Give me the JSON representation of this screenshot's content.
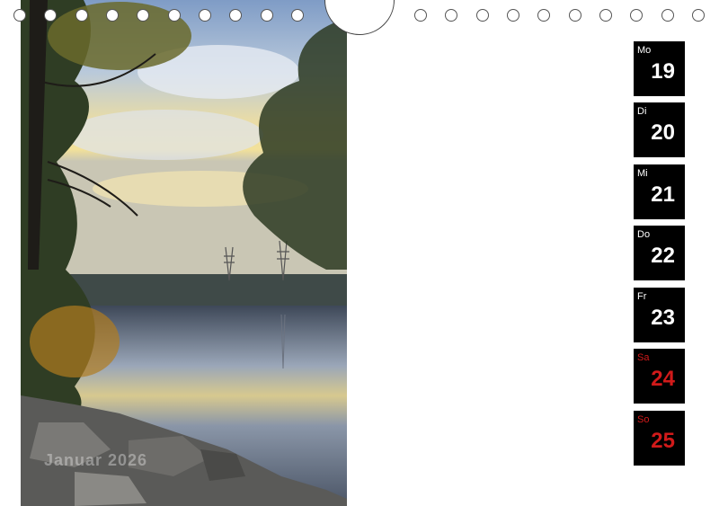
{
  "photo": {
    "caption": "Januar 2026",
    "description_icon": "lake-sunrise-photo"
  },
  "binding": {
    "hole_count_left": 10,
    "hole_count_right": 10
  },
  "days": [
    {
      "weekday": "Mo",
      "day": "19",
      "weekend": false
    },
    {
      "weekday": "Di",
      "day": "20",
      "weekend": false
    },
    {
      "weekday": "Mi",
      "day": "21",
      "weekend": false
    },
    {
      "weekday": "Do",
      "day": "22",
      "weekend": false
    },
    {
      "weekday": "Fr",
      "day": "23",
      "weekend": false
    },
    {
      "weekday": "Sa",
      "day": "24",
      "weekend": true
    },
    {
      "weekday": "So",
      "day": "25",
      "weekend": true
    }
  ],
  "colors": {
    "weekend": "#d11a1a",
    "tile": "#000000",
    "tile_text": "#ffffff"
  }
}
